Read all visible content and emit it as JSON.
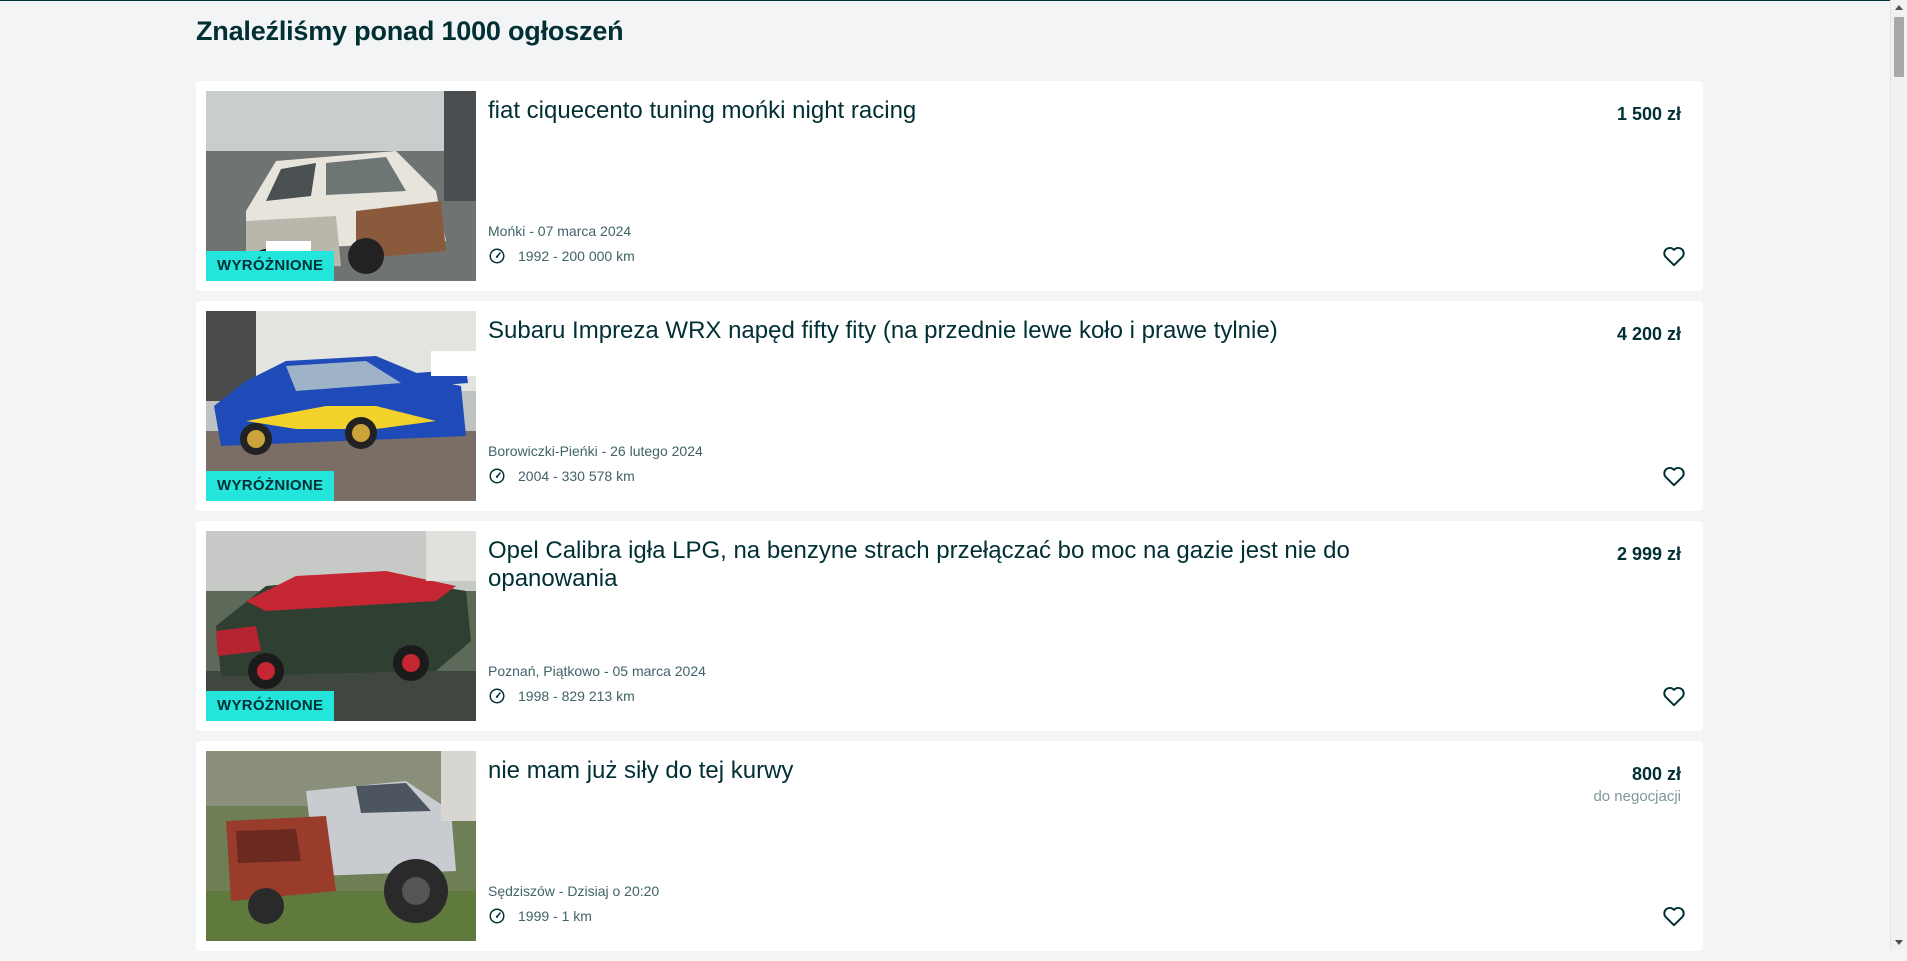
{
  "heading": "Znaleźliśmy ponad 1000 ogłoszeń",
  "colors": {
    "badge": "#23e5db",
    "text": "#002f34",
    "muted": "#406367",
    "background": "#f2f4f5"
  },
  "icons": {
    "odometer": "gauge-icon",
    "favorite": "heart-outline-icon"
  },
  "listings": [
    {
      "title": "fiat ciquecento tuning mońki night racing",
      "price": "1 500 zł",
      "negotiable": "",
      "location_date": "Mońki - 07 marca 2024",
      "year_mileage": "1992 - 200 000 km",
      "badge": "WYRÓŻNIONE"
    },
    {
      "title": "Subaru Impreza WRX napęd fifty fity (na przednie lewe koło i prawe tylnie)",
      "price": "4 200 zł",
      "negotiable": "",
      "location_date": "Borowiczki-Pieńki - 26 lutego 2024",
      "year_mileage": "2004 - 330 578 km",
      "badge": "WYRÓŻNIONE"
    },
    {
      "title": "Opel Calibra igła LPG, na benzyne strach przełączać bo moc na gazie jest nie do opanowania",
      "price": "2 999 zł",
      "negotiable": "",
      "location_date": "Poznań, Piątkowo - 05 marca 2024",
      "year_mileage": "1998 - 829 213 km",
      "badge": "WYRÓŻNIONE"
    },
    {
      "title": "nie mam już siły do tej kurwy",
      "price": "800 zł",
      "negotiable": "do negocjacji",
      "location_date": "Sędziszów - Dzisiaj o 20:20",
      "year_mileage": "1999 - 1 km",
      "badge": ""
    }
  ]
}
